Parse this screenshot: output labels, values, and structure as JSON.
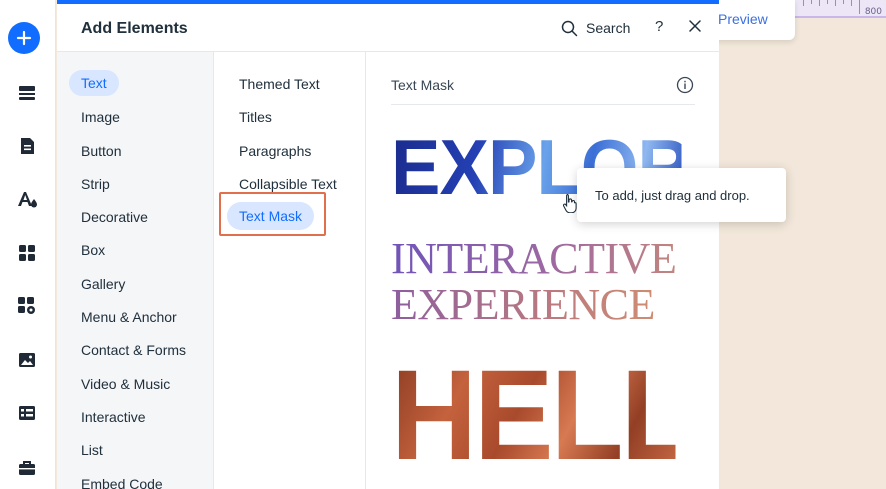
{
  "canvas": {
    "preview_label": "Preview",
    "ruler_label": "800"
  },
  "toolbar": {
    "items": [
      {
        "icon": "add-icon",
        "active": true
      },
      {
        "icon": "sections-icon"
      },
      {
        "icon": "pages-icon"
      },
      {
        "icon": "theme-icon"
      },
      {
        "icon": "apps-icon"
      },
      {
        "icon": "business-apps-icon"
      },
      {
        "icon": "media-icon"
      },
      {
        "icon": "cms-icon"
      },
      {
        "icon": "portfolio-icon"
      }
    ],
    "accent": "#116dff"
  },
  "panel": {
    "title": "Add Elements",
    "search_label": "Search",
    "help_label": "?",
    "categories": [
      "Text",
      "Image",
      "Button",
      "Strip",
      "Decorative",
      "Box",
      "Gallery",
      "Menu & Anchor",
      "Contact & Forms",
      "Video & Music",
      "Interactive",
      "List",
      "Embed Code"
    ],
    "active_category": "Text",
    "subcategories": [
      "Themed Text",
      "Titles",
      "Paragraphs",
      "Collapsible Text",
      "Text Mask"
    ],
    "active_subcategory": "Text Mask",
    "section_title": "Text Mask",
    "masks": {
      "explore": "EXPLORE",
      "interactive": "INTERACTIVE",
      "experience": "EXPERIENCE",
      "hello": "HELLO"
    },
    "tooltip": "To add, just drag and drop."
  }
}
